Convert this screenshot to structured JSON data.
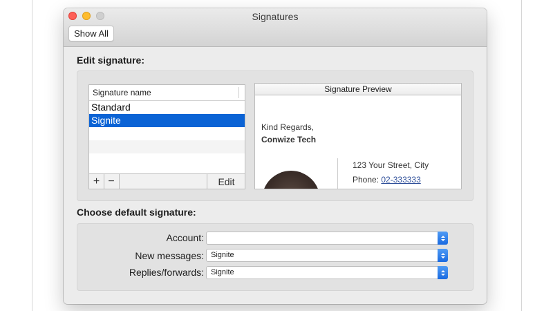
{
  "window": {
    "title": "Signatures"
  },
  "toolbar": {
    "show_all_label": "Show All"
  },
  "edit_section": {
    "label": "Edit signature:",
    "list": {
      "column_header": "Signature name",
      "items": [
        {
          "label": "Standard",
          "selected": false
        },
        {
          "label": "Signite",
          "selected": true
        }
      ],
      "add_label": "+",
      "remove_label": "−",
      "edit_label": "Edit"
    },
    "preview": {
      "header": "Signature Preview",
      "greeting": "Kind Regards,",
      "company": "Conwize Tech",
      "address": "123 Your Street, City",
      "phone_label": "Phone: ",
      "phone_number": "02-333333"
    }
  },
  "default_section": {
    "label": "Choose default signature:",
    "account": {
      "label": "Account:",
      "value": ""
    },
    "new_messages": {
      "label": "New messages:",
      "value": "Signite"
    },
    "replies": {
      "label": "Replies/forwards:",
      "value": "Signite"
    }
  },
  "colors": {
    "selection": "#0b63d5",
    "accent": "#1a6ae0"
  }
}
